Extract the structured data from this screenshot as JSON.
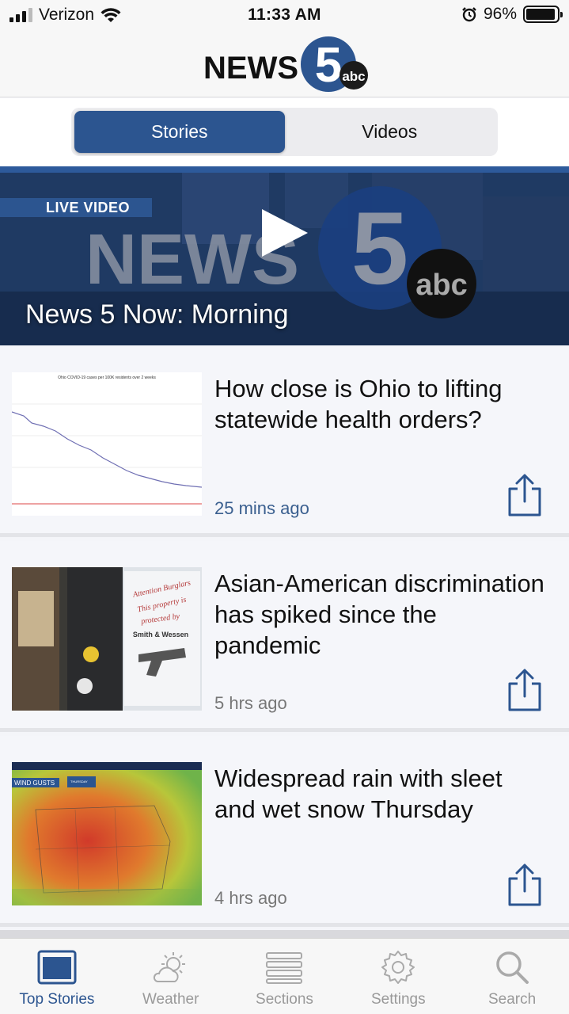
{
  "status_bar": {
    "carrier": "Verizon",
    "time": "11:33 AM",
    "battery": "96%",
    "battery_level": 0.96
  },
  "header": {
    "logo_text": "NEWS",
    "logo_number": "5",
    "logo_network": "abc"
  },
  "segments": [
    {
      "label": "Stories",
      "active": true
    },
    {
      "label": "Videos",
      "active": false
    }
  ],
  "hero": {
    "badge": "LIVE VIDEO",
    "title": "News 5 Now: Morning",
    "bg_logo_text": "NEWS",
    "bg_logo_number": "5",
    "bg_logo_network": "abc"
  },
  "stories": [
    {
      "headline": "How close is Ohio to lifting statewide health orders?",
      "time": "25 mins ago",
      "thumbnail": "covid-chart",
      "thumb_title": "Ohio COVID-19 cases per 100K residents over 2 weeks"
    },
    {
      "headline": "Asian-American discrimination has spiked since the pandemic",
      "time": "5 hrs ago",
      "thumbnail": "store-window-sign",
      "sign_text": [
        "Attention Burglars",
        "This property is",
        "protected by",
        "Smith & Wessen"
      ]
    },
    {
      "headline": "Widespread rain with sleet and wet snow Thursday",
      "time": "4 hrs ago",
      "thumbnail": "wind-gusts-map",
      "map_title": "WIND GUSTS",
      "map_day": "THURSDAY"
    }
  ],
  "tabs": [
    {
      "label": "Top Stories",
      "icon": "top-stories-icon",
      "active": true
    },
    {
      "label": "Weather",
      "icon": "weather-icon",
      "active": false
    },
    {
      "label": "Sections",
      "icon": "sections-icon",
      "active": false
    },
    {
      "label": "Settings",
      "icon": "settings-icon",
      "active": false
    },
    {
      "label": "Search",
      "icon": "search-icon",
      "active": false
    }
  ],
  "colors": {
    "accent": "#2c5590",
    "hero_bg": "#1d365f",
    "timestamp_blue": "#3a5f8f"
  }
}
